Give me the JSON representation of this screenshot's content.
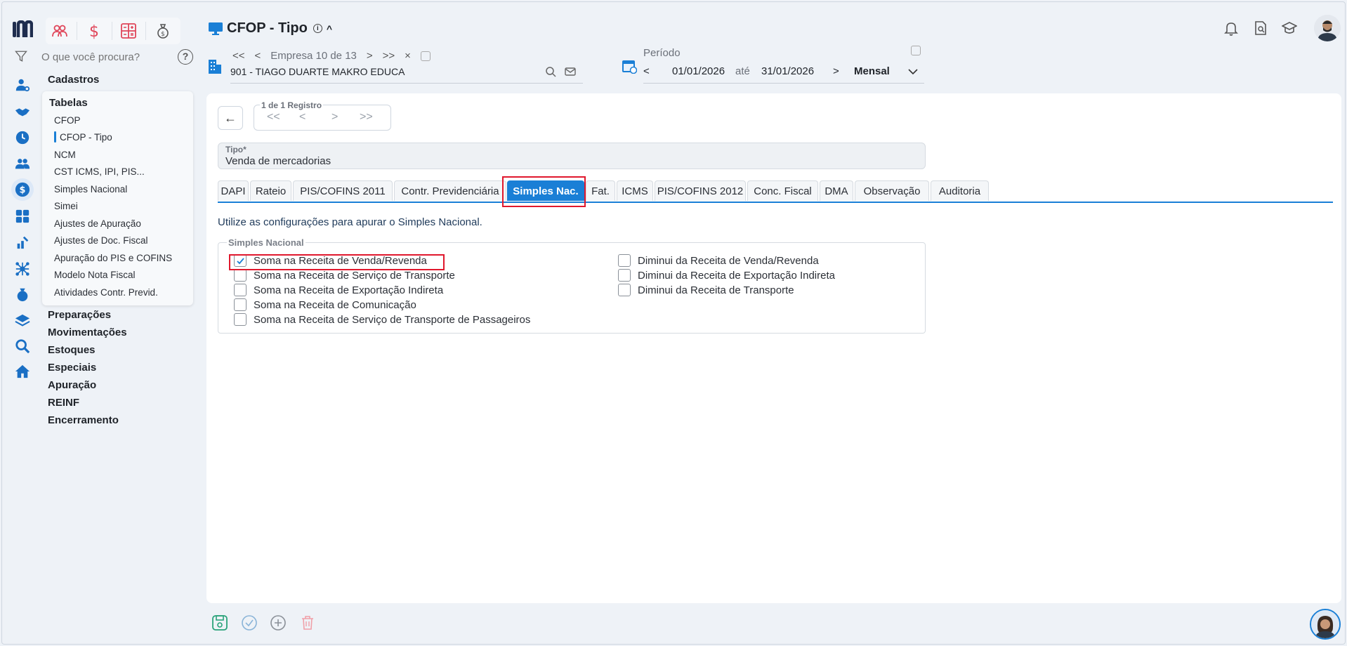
{
  "app": {
    "title": "CFOP - Tipo"
  },
  "search": {
    "placeholder": "O que você procura?",
    "help": "?"
  },
  "menu": {
    "cadastros": "Cadastros",
    "tabelas": "Tabelas",
    "tabelas_items": [
      "CFOP",
      "CFOP - Tipo",
      "NCM",
      "CST ICMS, IPI, PIS...",
      "Simples Nacional",
      "Simei",
      "Ajustes de Apuração",
      "Ajustes de Doc. Fiscal",
      "Apuração do PIS e COFINS",
      "Modelo Nota Fiscal",
      "Atividades Contr. Previd."
    ],
    "sections": [
      "Preparações",
      "Movimentações",
      "Estoques",
      "Especiais",
      "Apuração",
      "REINF",
      "Encerramento"
    ]
  },
  "company": {
    "nav_first": "<<",
    "nav_prev": "<",
    "counter": "Empresa 10 de 13",
    "nav_next": ">",
    "nav_last": ">>",
    "close": "×",
    "value": "901 - TIAGO DUARTE MAKRO EDUCA"
  },
  "period": {
    "label": "Período",
    "prev": "<",
    "start": "01/01/2026",
    "until": "até",
    "end": "31/01/2026",
    "next": ">",
    "mode": "Mensal"
  },
  "registro": {
    "label": "1 de 1 Registro",
    "first": "<<",
    "prev": "<",
    "next": ">",
    "last": ">>"
  },
  "tipo": {
    "label": "Tipo*",
    "value": "Venda de mercadorias"
  },
  "tabs": [
    "DAPI",
    "Rateio",
    "PIS/COFINS 2011",
    "Contr. Previdenciária",
    "Simples Nac.",
    "Fat.",
    "ICMS",
    "PIS/COFINS 2012",
    "Conc. Fiscal",
    "DMA",
    "Observação",
    "Auditoria"
  ],
  "active_tab": "Simples Nac.",
  "intro": "Utilize as configurações para apurar o Simples Nacional.",
  "simples_group": {
    "label": "Simples Nacional",
    "left": [
      {
        "label": "Soma na Receita de Venda/Revenda",
        "checked": true
      },
      {
        "label": "Soma na Receita de Serviço de Transporte",
        "checked": false
      },
      {
        "label": "Soma na Receita de Exportação Indireta",
        "checked": false
      },
      {
        "label": "Soma na Receita de Comunicação",
        "checked": false
      },
      {
        "label": "Soma na Receita de Serviço de Transporte de Passageiros",
        "checked": false
      }
    ],
    "right": [
      {
        "label": "Diminui da Receita de Venda/Revenda",
        "checked": false
      },
      {
        "label": "Diminui da Receita de Exportação Indireta",
        "checked": false
      },
      {
        "label": "Diminui da Receita de Transporte",
        "checked": false
      }
    ]
  },
  "colors": {
    "accent": "#1a7fd6",
    "highlight": "#e0182d",
    "module_red": "#e0465a",
    "save_green": "#2aa37a"
  }
}
